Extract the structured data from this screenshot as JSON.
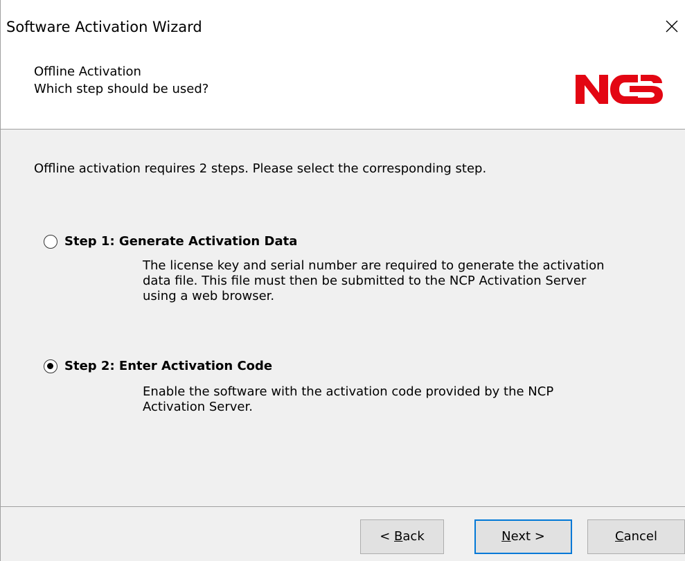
{
  "window": {
    "title": "Software Activation Wizard",
    "close_icon": "close-icon"
  },
  "header": {
    "title": "Offline Activation",
    "subtitle": "Which step should be used?",
    "logo_text": "NCP",
    "logo_color": "#e30613"
  },
  "body": {
    "intro": "Offline activation requires 2 steps. Please select the corresponding step.",
    "options": [
      {
        "label": "Step 1: Generate Activation Data",
        "selected": false,
        "description_lines": [
          "The license key and serial number are required to generate the activation",
          "data file. This file must then be submitted to the NCP Activation Server",
          "using a web browser."
        ]
      },
      {
        "label": "Step 2: Enter Activation Code",
        "selected": true,
        "description_lines": [
          "Enable the software with the activation code provided by the NCP",
          "Activation Server."
        ]
      }
    ]
  },
  "footer": {
    "back": {
      "prefix": "< ",
      "mnemonic": "B",
      "rest": "ack"
    },
    "next": {
      "mnemonic": "N",
      "rest": "ext >"
    },
    "cancel": {
      "mnemonic": "C",
      "rest": "ancel"
    }
  },
  "colors": {
    "accent": "#0078d7",
    "panel_bg": "#f0f0f0",
    "header_bg": "#ffffff"
  }
}
